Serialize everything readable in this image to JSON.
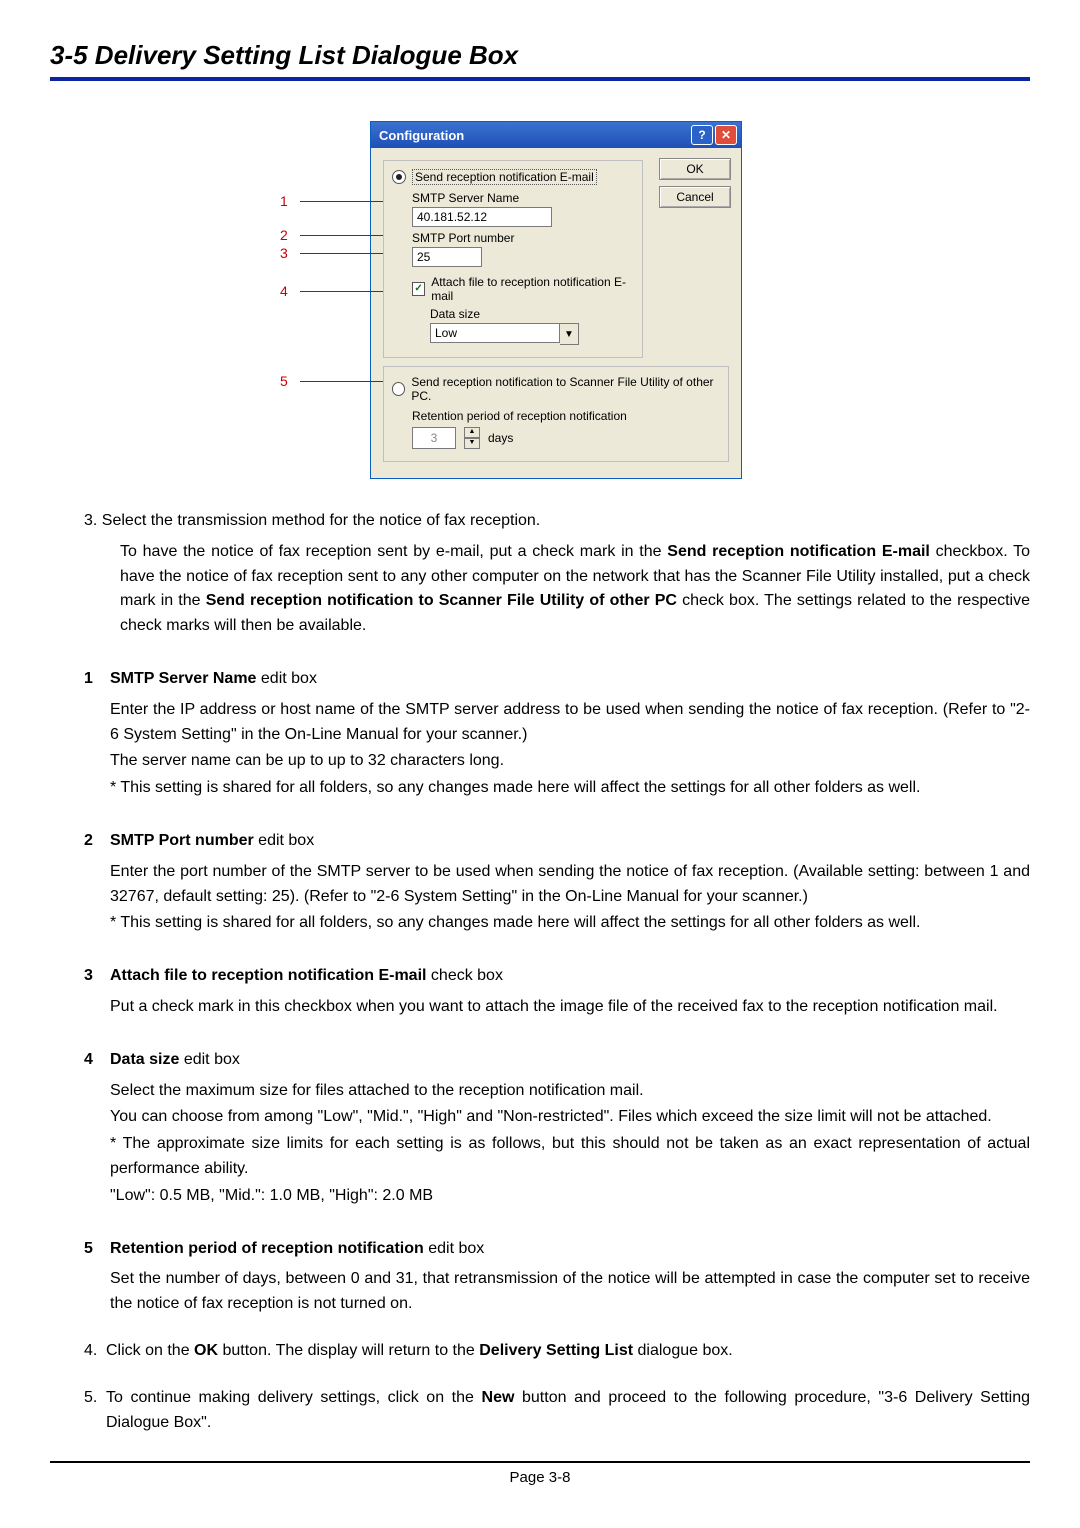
{
  "title": "3-5  Delivery Setting List Dialogue Box",
  "dialog": {
    "windowTitle": "Configuration",
    "helpGlyph": "?",
    "closeGlyph": "✕",
    "okLabel": "OK",
    "cancelLabel": "Cancel",
    "radioEmailLabel": "Send reception notification E-mail",
    "smtpServerLabel": "SMTP Server Name",
    "smtpServerValue": "40.181.52.12",
    "smtpPortLabel": "SMTP Port number",
    "smtpPortValue": "25",
    "attachLabel": "Attach file to reception notification E-mail",
    "dataSizeLabel": "Data size",
    "dataSizeValue": "Low",
    "radioOtherPCLabel": "Send reception notification to Scanner File Utility of other PC.",
    "retentionLabel": "Retention period of reception notification",
    "retentionValue": "3",
    "daysLabel": "days"
  },
  "callouts": [
    "1",
    "2",
    "3",
    "4",
    "5"
  ],
  "intro": {
    "lead": "3. Select the transmission method for the notice of fax reception.",
    "p1a": "To have the notice of fax reception sent by e-mail, put a check mark in the ",
    "p1bold": "Send reception notification E-mail",
    "p1b": " checkbox. To have the notice of fax reception sent to any other computer on the network that has the Scanner File Utility installed, put a check mark in the ",
    "p1bold2": "Send reception notification to Scanner File Utility of other PC",
    "p1c": " check box. The settings related to the respective check marks will then be available."
  },
  "items": [
    {
      "n": "1",
      "titleBold": "SMTP Server Name",
      "titleRest": " edit box",
      "desc": [
        "Enter the IP address or host name of the SMTP server address to be used when sending the notice of fax reception. (Refer to \"2-6 System Setting\" in the On-Line Manual for your scanner.)",
        "The server name can be up to up to 32 characters long.",
        "* This setting is shared for all folders, so any changes made here will affect the settings for all other folders as well."
      ]
    },
    {
      "n": "2",
      "titleBold": "SMTP Port number",
      "titleRest": " edit box",
      "desc": [
        "Enter the port number of the SMTP server to be used when sending the notice of fax reception. (Available setting: between 1 and 32767, default setting: 25). (Refer to \"2-6 System Setting\" in the On-Line Manual for your scanner.)",
        "* This setting is shared for all folders, so any changes made here will affect the settings for all other folders as well."
      ]
    },
    {
      "n": "3",
      "titleBold": "Attach file to reception notification E-mail",
      "titleRest": " check box",
      "desc": [
        "Put a check mark in this checkbox when you want to attach the image file of the received fax to the reception notification mail."
      ]
    },
    {
      "n": "4",
      "titleBold": "Data size",
      "titleRest": " edit box",
      "desc": [
        "Select the maximum size for files attached to the reception notification mail.",
        "You can choose from among \"Low\", \"Mid.\", \"High\" and \"Non-restricted\". Files which exceed the size limit will not be attached.",
        "* The approximate size limits for each setting is as follows, but this should not be taken as an exact representation of actual performance ability.",
        "\"Low\": 0.5 MB, \"Mid.\": 1.0 MB, \"High\": 2.0 MB"
      ]
    },
    {
      "n": "5",
      "titleBold": "Retention period of reception notification",
      "titleRest": " edit box",
      "desc": [
        "Set the number of days, between 0 and 31, that retransmission of the notice will be attempted in case the computer set to receive the notice of fax reception is not turned on."
      ]
    }
  ],
  "step4": {
    "n": "4.",
    "a": "Click on the ",
    "b1": "OK",
    "mid": " button. The display will return to the ",
    "b2": "Delivery Setting List",
    "c": " dialogue box."
  },
  "step5": {
    "n": "5.",
    "a": "To continue making delivery settings, click on the ",
    "b1": "New",
    "c": " button and proceed to the following procedure, \"3-6 Delivery Setting Dialogue Box\"."
  },
  "pageNumber": "Page 3-8"
}
